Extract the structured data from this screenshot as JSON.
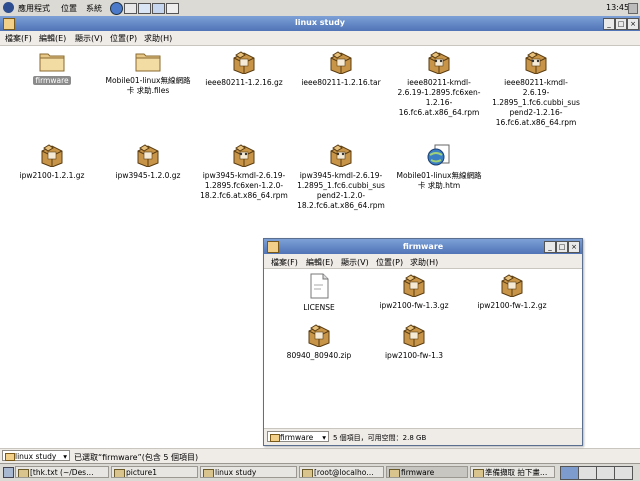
{
  "topbar": {
    "menus": [
      "應用程式",
      "位置",
      "系統"
    ],
    "clock": "13:45"
  },
  "window": {
    "title": "linux study",
    "menus": [
      "檔案(F)",
      "編輯(E)",
      "顯示(V)",
      "位置(P)",
      "求助(H)"
    ]
  },
  "files": [
    {
      "name": "firmware",
      "type": "folder",
      "selected": true
    },
    {
      "name": "Mobile01-linux無線網路卡 求助.files",
      "type": "folder"
    },
    {
      "name": "ieee80211-1.2.16.gz",
      "type": "package"
    },
    {
      "name": "ieee80211-1.2.16.tar",
      "type": "package"
    },
    {
      "name": "ieee80211-kmdl-2.6.19-1.2895.fc6xen-1.2.16-16.fc6.at.x86_64.rpm",
      "type": "rpm"
    },
    {
      "name": "ieee80211-kmdl-2.6.19-1.2895_1.fc6.cubbi_suspend2-1.2.16-16.fc6.at.x86_64.rpm",
      "type": "rpm"
    },
    {
      "name": "ipw2100-1.2.1.gz",
      "type": "package"
    },
    {
      "name": "ipw3945-1.2.0.gz",
      "type": "package"
    },
    {
      "name": "ipw3945-kmdl-2.6.19-1.2895.fc6xen-1.2.0-18.2.fc6.at.x86_64.rpm",
      "type": "rpm"
    },
    {
      "name": "ipw3945-kmdl-2.6.19-1.2895_1.fc6.cubbi_suspend2-1.2.0-18.2.fc6.at.x86_64.rpm",
      "type": "rpm"
    },
    {
      "name": "Mobile01-linux無線網路卡 求助.htm",
      "type": "html"
    }
  ],
  "statusbar": {
    "location": "linux study",
    "text": "已選取“firmware”(包含 5 個項目)"
  },
  "firmware_window": {
    "title": "firmware",
    "menus": [
      "檔案(F)",
      "編輯(E)",
      "顯示(V)",
      "位置(P)",
      "求助(H)"
    ],
    "files": [
      {
        "name": "LICENSE",
        "type": "text"
      },
      {
        "name": "ipw2100-fw-1.3.gz",
        "type": "package"
      },
      {
        "name": "ipw2100-fw-1.2.gz",
        "type": "package"
      },
      {
        "name": "80940_80940.zip",
        "type": "package"
      },
      {
        "name": "ipw2100-fw-1.3",
        "type": "package"
      }
    ],
    "location": "firmware",
    "status": "5 個項目，可用空間：2.8 GB"
  },
  "taskbar": {
    "items": [
      {
        "label": "[thk.txt (~/Des…",
        "active": false
      },
      {
        "label": "picture1",
        "active": false
      },
      {
        "label": "linux study",
        "active": false
      },
      {
        "label": "[root@localho…",
        "active": false
      },
      {
        "label": "firmware",
        "active": true
      },
      {
        "label": "準備擷取 拍下畫…",
        "active": false
      }
    ]
  }
}
